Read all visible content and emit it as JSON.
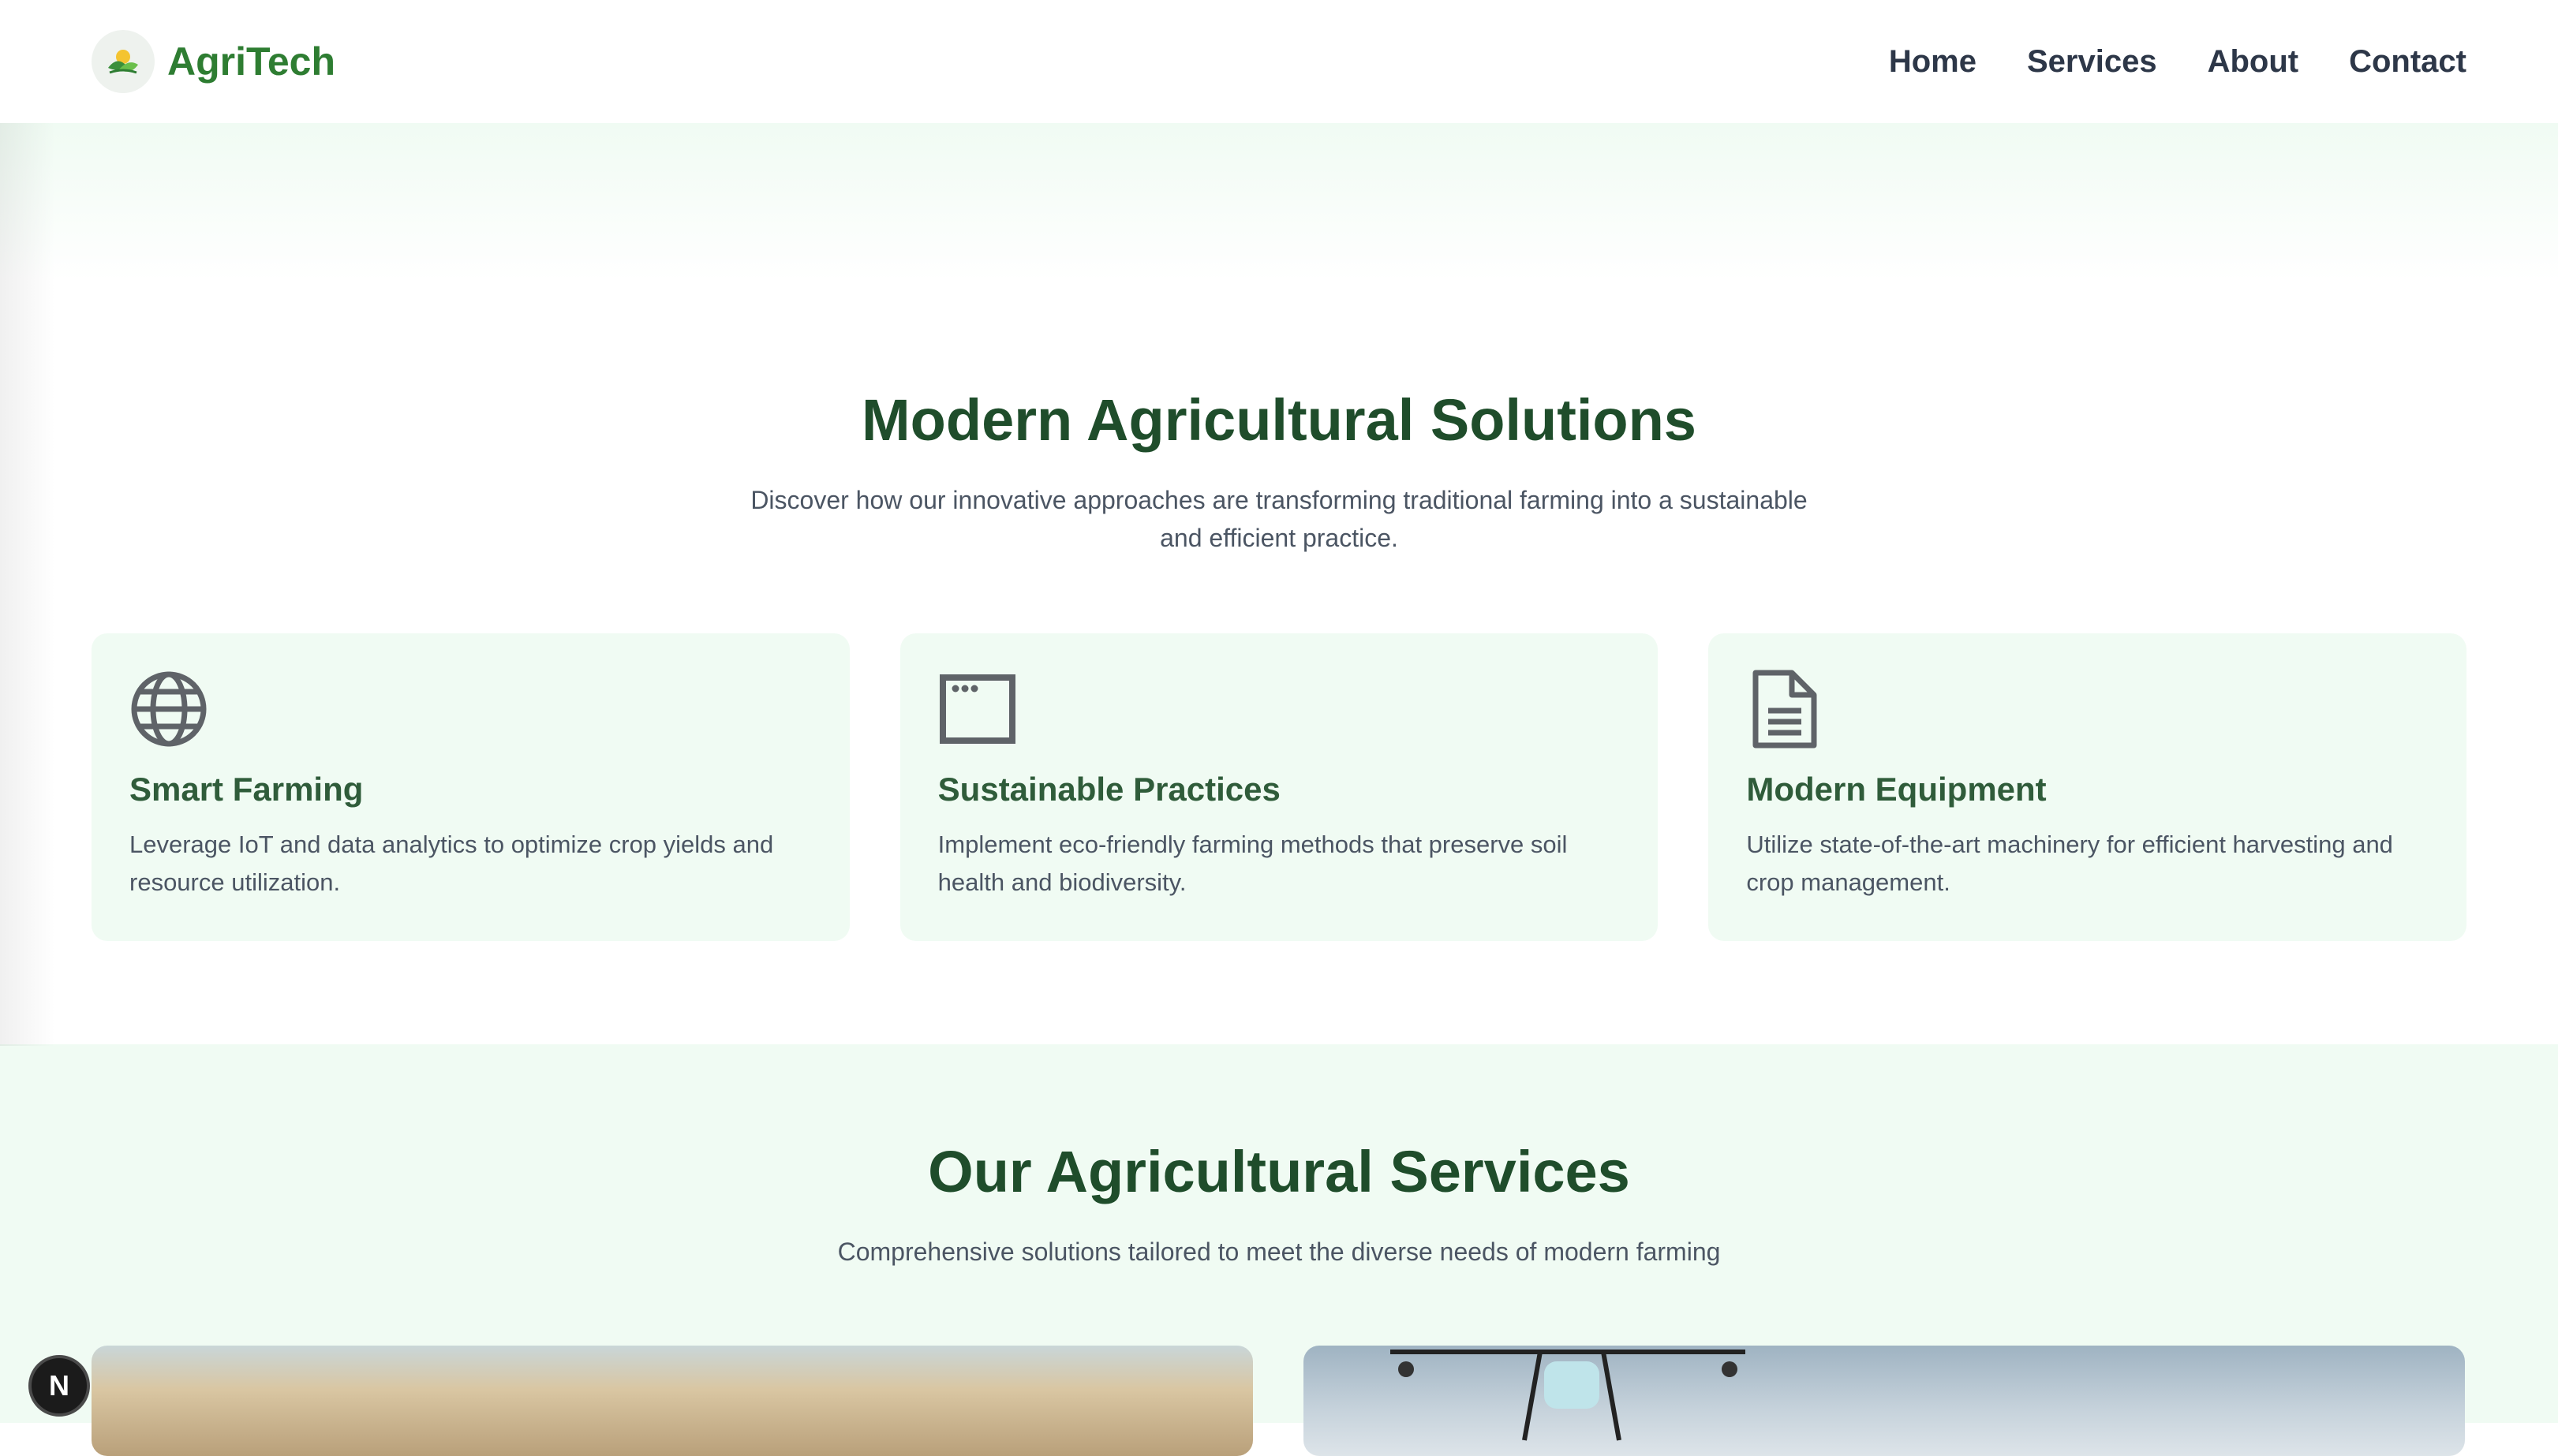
{
  "nav": {
    "brand": "AgriTech",
    "links": [
      "Home",
      "Services",
      "About",
      "Contact"
    ]
  },
  "hero": {
    "title": "Modern Agricultural Solutions",
    "subtitle_line1": "Discover how our innovative approaches are transforming traditional farming into a sustainable",
    "subtitle_line2": "and efficient practice."
  },
  "features": [
    {
      "icon": "globe-icon",
      "title": "Smart Farming",
      "text": "Leverage IoT and data analytics to optimize crop yields and resource utilization."
    },
    {
      "icon": "browser-window-icon",
      "title": "Sustainable Practices",
      "text": "Implement eco-friendly farming methods that preserve soil health and biodiversity."
    },
    {
      "icon": "document-icon",
      "title": "Modern Equipment",
      "text": "Utilize state-of-the-art machinery for efficient harvesting and crop management."
    }
  ],
  "services": {
    "title": "Our Agricultural Services",
    "subtitle": "Comprehensive solutions tailored to meet the diverse needs of modern farming"
  },
  "badge": "N",
  "colors": {
    "brand_green": "#2e7d32",
    "heading_green": "#1f4d2b",
    "card_bg": "#f0fbf3",
    "nav_text": "#2d3748"
  }
}
